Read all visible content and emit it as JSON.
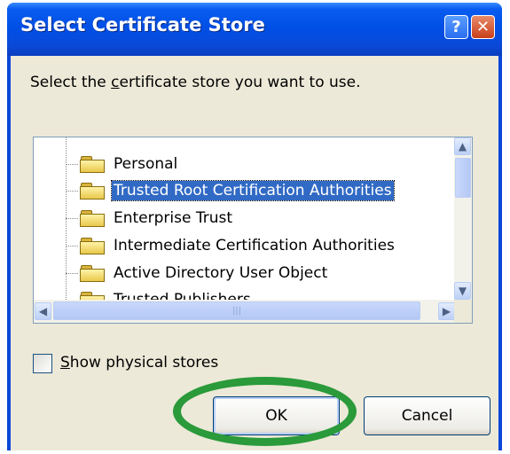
{
  "dialog": {
    "title": "Select Certificate Store",
    "help_glyph": "?",
    "close_glyph": "✕"
  },
  "prompt": {
    "before": "Select the ",
    "mnemonic": "c",
    "after": "ertificate store you want to use."
  },
  "stores": [
    {
      "label": "Personal",
      "selected": false
    },
    {
      "label": "Trusted Root Certification Authorities",
      "selected": true
    },
    {
      "label": "Enterprise Trust",
      "selected": false
    },
    {
      "label": "Intermediate Certification Authorities",
      "selected": false
    },
    {
      "label": "Active Directory User Object",
      "selected": false
    },
    {
      "label": "Trusted Publishers",
      "selected": false
    }
  ],
  "scroll": {
    "up_glyph": "▲",
    "down_glyph": "▼",
    "left_glyph": "◀",
    "right_glyph": "▶",
    "grip_glyph": "|||"
  },
  "checkbox": {
    "mnemonic": "S",
    "rest": "how physical stores",
    "checked": false
  },
  "buttons": {
    "ok": "OK",
    "cancel": "Cancel"
  },
  "colors": {
    "selection": "#316ac5",
    "highlight_ring": "#2a9a3a",
    "titlebar": "#0050e6"
  }
}
